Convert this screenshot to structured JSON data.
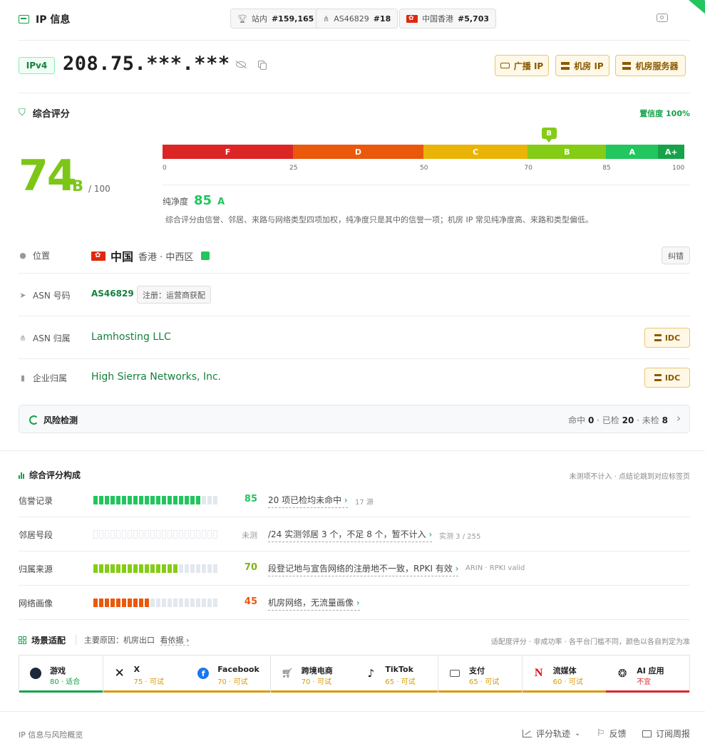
{
  "header": {
    "title": "IP 信息",
    "site_rank_label": "站内",
    "site_rank": "#159,165",
    "asn_label": "AS46829",
    "asn_rank": "#18",
    "region_label": "中国香港",
    "region_rank": "#5,703"
  },
  "ip": {
    "version": "IPv4",
    "address": "208.75.***.***",
    "tags": [
      "广播 IP",
      "机房 IP",
      "机房服务器"
    ]
  },
  "score": {
    "section_title": "综合评分",
    "confidence": "置信度 100%",
    "value": "74",
    "grade": "B",
    "max": "/ 100",
    "marker": "B",
    "segments": [
      {
        "label": "F",
        "from": 0,
        "to": 25,
        "color": "#dc2626"
      },
      {
        "label": "D",
        "from": 25,
        "to": 50,
        "color": "#ea580c"
      },
      {
        "label": "C",
        "from": 50,
        "to": 70,
        "color": "#eab308"
      },
      {
        "label": "B",
        "from": 70,
        "to": 85,
        "color": "#84cc16"
      },
      {
        "label": "A",
        "from": 85,
        "to": 95,
        "color": "#22c55e"
      },
      {
        "label": "A+",
        "from": 95,
        "to": 100,
        "color": "#16a34a"
      }
    ],
    "ticks": [
      "0",
      "25",
      "50",
      "70",
      "85",
      "100"
    ],
    "purity_label": "纯净度",
    "purity_value": "85",
    "purity_grade": "A",
    "note": "综合评分由信誉、邻居、来路与网络类型四项加权，纯净度只是其中的信誉一项；机房 IP 常见纯净度高、来路和类型偏低。"
  },
  "info": {
    "location_label": "位置",
    "country": "中国",
    "region": "香港 · 中西区",
    "report_button": "纠错",
    "asn_label": "ASN 号码",
    "asn": "AS46829",
    "asn_reg": "注册：运营商获配",
    "asn_owner_label": "ASN 归属",
    "asn_owner": "Lamhosting LLC",
    "org_label": "企业归属",
    "org": "High Sierra Networks, Inc.",
    "idc_label": "IDC"
  },
  "risk": {
    "title": "风险检测",
    "hit_label": "命中",
    "hit": "0",
    "checked_label": "已检",
    "checked": "20",
    "unchecked_label": "未检",
    "unchecked": "8"
  },
  "breakdown": {
    "title": "综合评分构成",
    "hint": "未测项不计入 · 点结论跳到对应标签页",
    "rows": [
      {
        "label": "信誉记录",
        "score": "85",
        "fill": 0.85,
        "color": "#22c55e",
        "score_color": "#22c55e",
        "text": "20 项已检均未命中",
        "sub": "17 源"
      },
      {
        "label": "邻居号段",
        "score": "未测",
        "fill": 0,
        "color": "#e3e8ef",
        "score_color": "#999999",
        "text": "/24 实测邻居 3 个，不足 8 个，暂不计入",
        "sub": "实测 3 / 255"
      },
      {
        "label": "归属来源",
        "score": "70",
        "fill": 0.7,
        "color": "#84cc16",
        "score_color": "#7cb518",
        "text": "段登记地与宣告网络的注册地不一致，RPKI 有效",
        "sub": "ARIN · RPKI valid"
      },
      {
        "label": "网络画像",
        "score": "45",
        "fill": 0.45,
        "color": "#ea580c",
        "score_color": "#ea580c",
        "text": "机房网络，无流量画像",
        "sub": ""
      }
    ]
  },
  "scenarios": {
    "title": "场景适配",
    "reason_label": "主要原因：机房出口",
    "reason_link": "看依据",
    "hint": "适配度评分 · 非成功率 · 各平台门槛不同，颜色以各自判定为准",
    "items": [
      {
        "name": "游戏",
        "score": "80 · 适合",
        "color": "#16a34a",
        "icon": "steam-icon"
      },
      {
        "name": "X",
        "score": "75 · 可试",
        "color": "#d99a06",
        "icon": "x-icon"
      },
      {
        "name": "Facebook",
        "score": "70 · 可试",
        "color": "#d99a06",
        "icon": "facebook-icon"
      },
      {
        "name": "跨境电商",
        "score": "70 · 可试",
        "color": "#d99a06",
        "icon": "cart-icon"
      },
      {
        "name": "TikTok",
        "score": "65 · 可试",
        "color": "#d99a06",
        "icon": "tiktok-icon"
      },
      {
        "name": "支付",
        "score": "65 · 可试",
        "color": "#d99a06",
        "icon": "card-icon"
      },
      {
        "name": "流媒体",
        "score": "60 · 可试",
        "color": "#d99a06",
        "icon": "netflix-icon"
      },
      {
        "name": "AI 应用",
        "score": "不宜",
        "color": "#dc2626",
        "icon": "openai-icon"
      }
    ]
  },
  "footer": {
    "left": "IP 信息与风险概览",
    "track": "评分轨迹",
    "feedback": "反馈",
    "subscribe": "订阅周报"
  }
}
